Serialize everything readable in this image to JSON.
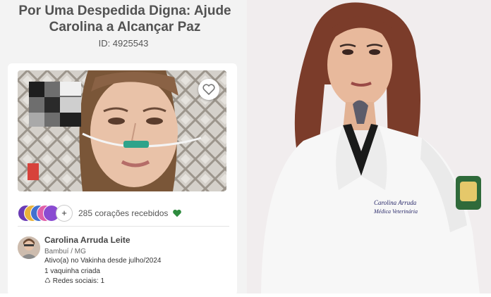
{
  "campaign": {
    "title": "Por Uma Despedida Digna: Ajude Carolina a Alcançar Paz",
    "id_label": "ID: 4925543"
  },
  "engagement": {
    "hearts_count": "285 corações recebidos",
    "more_symbol": "+",
    "accent_color": "#2e8b3e"
  },
  "creator": {
    "name": "Carolina Arruda Leite",
    "location": "Bambuí / MG",
    "active_since": "Ativo(a) no Vakinha desde julho/2024",
    "campaigns_created": "1 vaquinha criada",
    "social": "♺ Redes sociais: 1"
  },
  "portrait": {
    "coat_name": "Carolina Arruda",
    "coat_title": "Médica Veterinária"
  },
  "icons": {
    "favorite": "heart-outline-icon",
    "hearts": "green-heart-icon"
  }
}
